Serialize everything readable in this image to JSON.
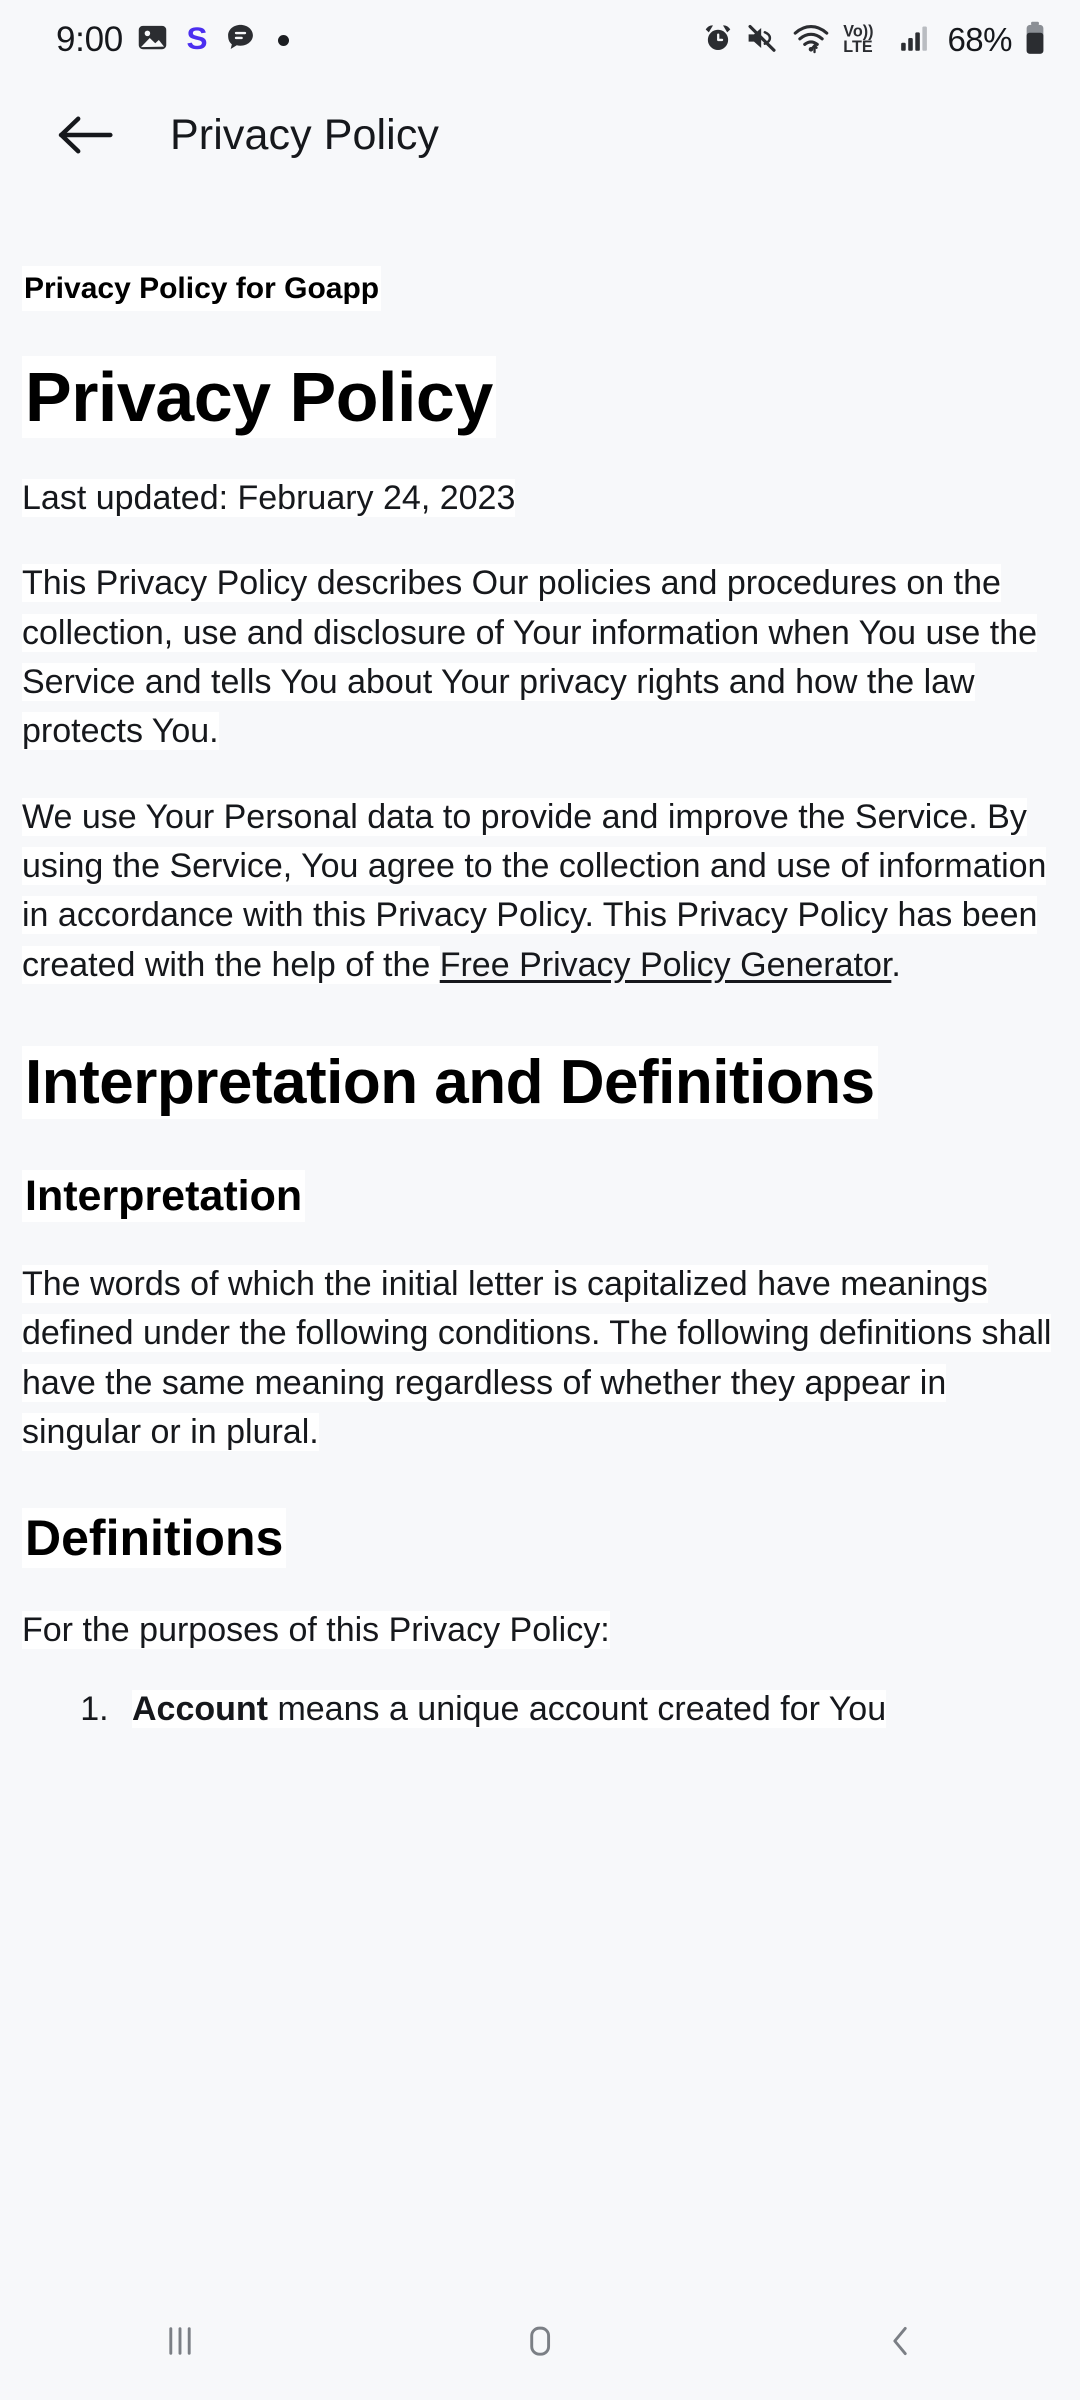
{
  "status_bar": {
    "time": "9:00",
    "battery_percent": "68%",
    "left_icons": [
      {
        "name": "photo-icon",
        "label": "photos"
      },
      {
        "name": "samsung-internet-icon",
        "label": "S"
      },
      {
        "name": "message-icon",
        "label": "messages"
      },
      {
        "name": "notification-dot-icon",
        "label": "more notifications"
      }
    ],
    "right_icons": [
      {
        "name": "alarm-icon",
        "label": "alarm set"
      },
      {
        "name": "mute-icon",
        "label": "sound off"
      },
      {
        "name": "wifi-icon",
        "label": "wi-fi"
      },
      {
        "name": "volte-icon",
        "label": "VoLTE"
      },
      {
        "name": "signal-bars-icon",
        "label": "cellular signal"
      },
      {
        "name": "battery-icon",
        "label": "battery"
      }
    ],
    "volte_top": "Vo))",
    "volte_bottom": "LTE"
  },
  "app_bar": {
    "back_label": "Back",
    "title": "Privacy Policy"
  },
  "document": {
    "subtitle": "Privacy Policy for Goapp",
    "h1": "Privacy Policy",
    "last_updated": "Last updated: February 24, 2023",
    "paragraph_1": "This Privacy Policy describes Our policies and procedures on the collection, use and disclosure of Your information when You use the Service and tells You about Your privacy rights and how the law protects You.",
    "paragraph_2_before_link": "We use Your Personal data to provide and improve the Service. By using the Service, You agree to the collection and use of information in accordance with this Privacy Policy. This Privacy Policy has been created with the help of the ",
    "paragraph_2_link": "Free Privacy Policy Generator",
    "paragraph_2_after_link": ".",
    "h2_interpretation_definitions": "Interpretation and Definitions",
    "h3_interpretation": "Interpretation",
    "paragraph_interpretation": "The words of which the initial letter is capitalized have meanings defined under the following conditions. The following definitions shall have the same meaning regardless of whether they appear in singular or in plural.",
    "h3_definitions": "Definitions",
    "paragraph_definitions_intro": "For the purposes of this Privacy Policy:",
    "list_items": [
      {
        "term": "Account",
        "rest": " means a unique account created for You"
      }
    ]
  },
  "nav_bar": {
    "recents_label": "Recent apps",
    "home_label": "Home",
    "back_label": "Back"
  },
  "colors": {
    "background": "#f7f8fa",
    "text": "#16181c",
    "highlight": "#ffffff",
    "nav_icon": "#7b7f85",
    "accent_purple": "#4b2ef0"
  }
}
